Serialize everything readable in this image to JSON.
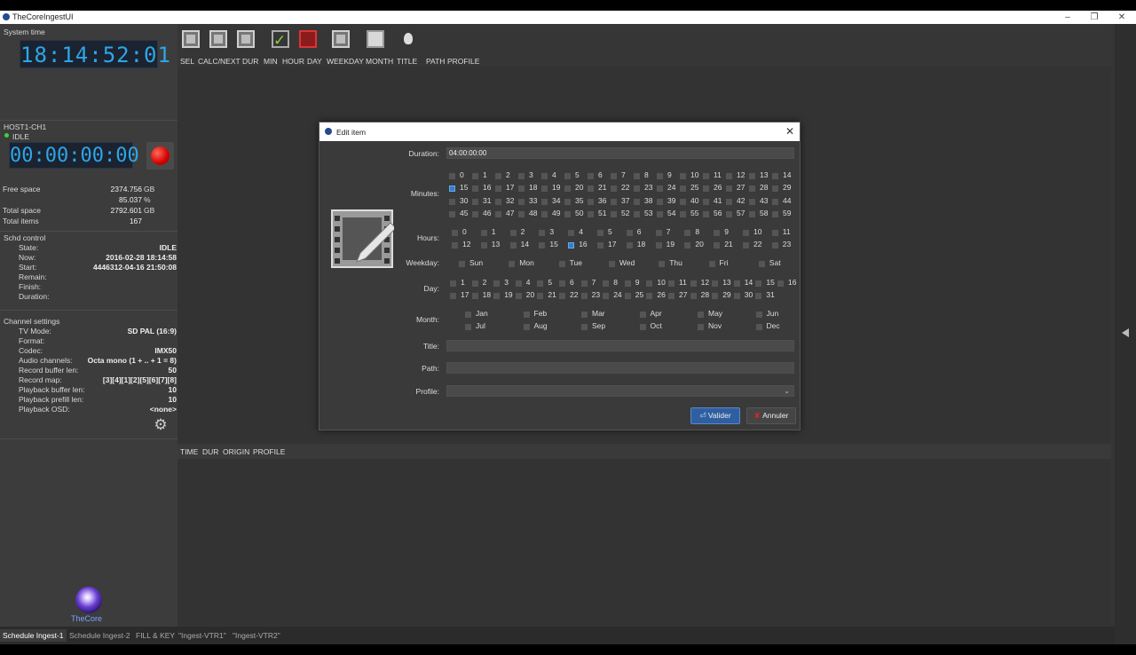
{
  "window": {
    "title": "TheCoreIngestUI",
    "minimize": "–",
    "restore": "❐",
    "close": "✕"
  },
  "left": {
    "system_time_label": "System time",
    "system_time": "18:14:52:01",
    "channel_name": "HOST1-CH1",
    "channel_state": "IDLE",
    "channel_timecode": "00:00:00:00",
    "stats": [
      {
        "key": "Free space",
        "value": "2374.756",
        "unit": "GB"
      },
      {
        "key": "",
        "value": "85.037",
        "unit": "%"
      },
      {
        "key": "Total space",
        "value": "2792.601",
        "unit": "GB"
      },
      {
        "key": "Total items",
        "value": "167",
        "unit": ""
      }
    ],
    "schd_title": "Schd control",
    "schd": [
      {
        "key": "State:",
        "value": "IDLE"
      },
      {
        "key": "Now:",
        "value": "2016-02-28 18:14:58"
      },
      {
        "key": "Start:",
        "value": "4446312-04-16 21:50:08"
      },
      {
        "key": "Remain:",
        "value": ""
      },
      {
        "key": "Finish:",
        "value": ""
      },
      {
        "key": "Duration:",
        "value": ""
      }
    ],
    "channel_settings_title": "Channel settings",
    "channel_settings": [
      {
        "key": "TV Mode:",
        "value": "SD PAL (16:9)"
      },
      {
        "key": "Format:",
        "value": ""
      },
      {
        "key": "Codec:",
        "value": "IMX50"
      },
      {
        "key": "Audio channels:",
        "value": "Octa mono (1 + .. + 1 = 8)"
      },
      {
        "key": "Record buffer len:",
        "value": "50"
      },
      {
        "key": "Record map:",
        "value": "[3][4][1][2][5][6][7][8]"
      },
      {
        "key": "Playback buffer len:",
        "value": "10"
      },
      {
        "key": "Playback prefill len:",
        "value": "10"
      },
      {
        "key": "Playback OSD:",
        "value": "<none>"
      }
    ],
    "logo_text": "TheCore"
  },
  "toolbar": {
    "columns": [
      "SEL",
      "CALC/NEXT",
      "DUR",
      "MIN",
      "HOUR",
      "DAY",
      "WEEKDAY",
      "MONTH",
      "TITLE",
      "PATH",
      "PROFILE"
    ],
    "icons": [
      "film-icon",
      "film-icon",
      "film-icon",
      "check-icon",
      "red-film-icon",
      "film-icon",
      "square-icon",
      "bulb-icon"
    ]
  },
  "list_columns": [
    "TIME",
    "DUR",
    "ORIGIN",
    "PROFILE"
  ],
  "bottom_tabs": [
    "Schedule Ingest-1",
    "Schedule Ingest-2",
    "FILL & KEY",
    "\"Ingest-VTR1\"",
    "\"Ingest-VTR2\""
  ],
  "dialog": {
    "title": "Edit item",
    "duration_label": "Duration:",
    "duration_value": "04:00:00:00",
    "minutes_label": "Minutes:",
    "minutes_checked": [
      15
    ],
    "hours_label": "Hours:",
    "hours_checked": [
      16
    ],
    "weekday_label": "Weekday:",
    "weekdays": [
      "Sun",
      "Mon",
      "Tue",
      "Wed",
      "Thu",
      "Fri",
      "Sat"
    ],
    "day_label": "Day:",
    "month_label": "Month:",
    "months": [
      "Jan",
      "Feb",
      "Mar",
      "Apr",
      "May",
      "Jun",
      "Jul",
      "Aug",
      "Sep",
      "Oct",
      "Nov",
      "Dec"
    ],
    "title_label": "Title:",
    "path_label": "Path:",
    "profile_label": "Profile:",
    "ok_label": "Valider",
    "cancel_label": "Annuler",
    "colors": {
      "checked": "#2f7fd1",
      "ok_button": "#2f5fa0"
    }
  }
}
